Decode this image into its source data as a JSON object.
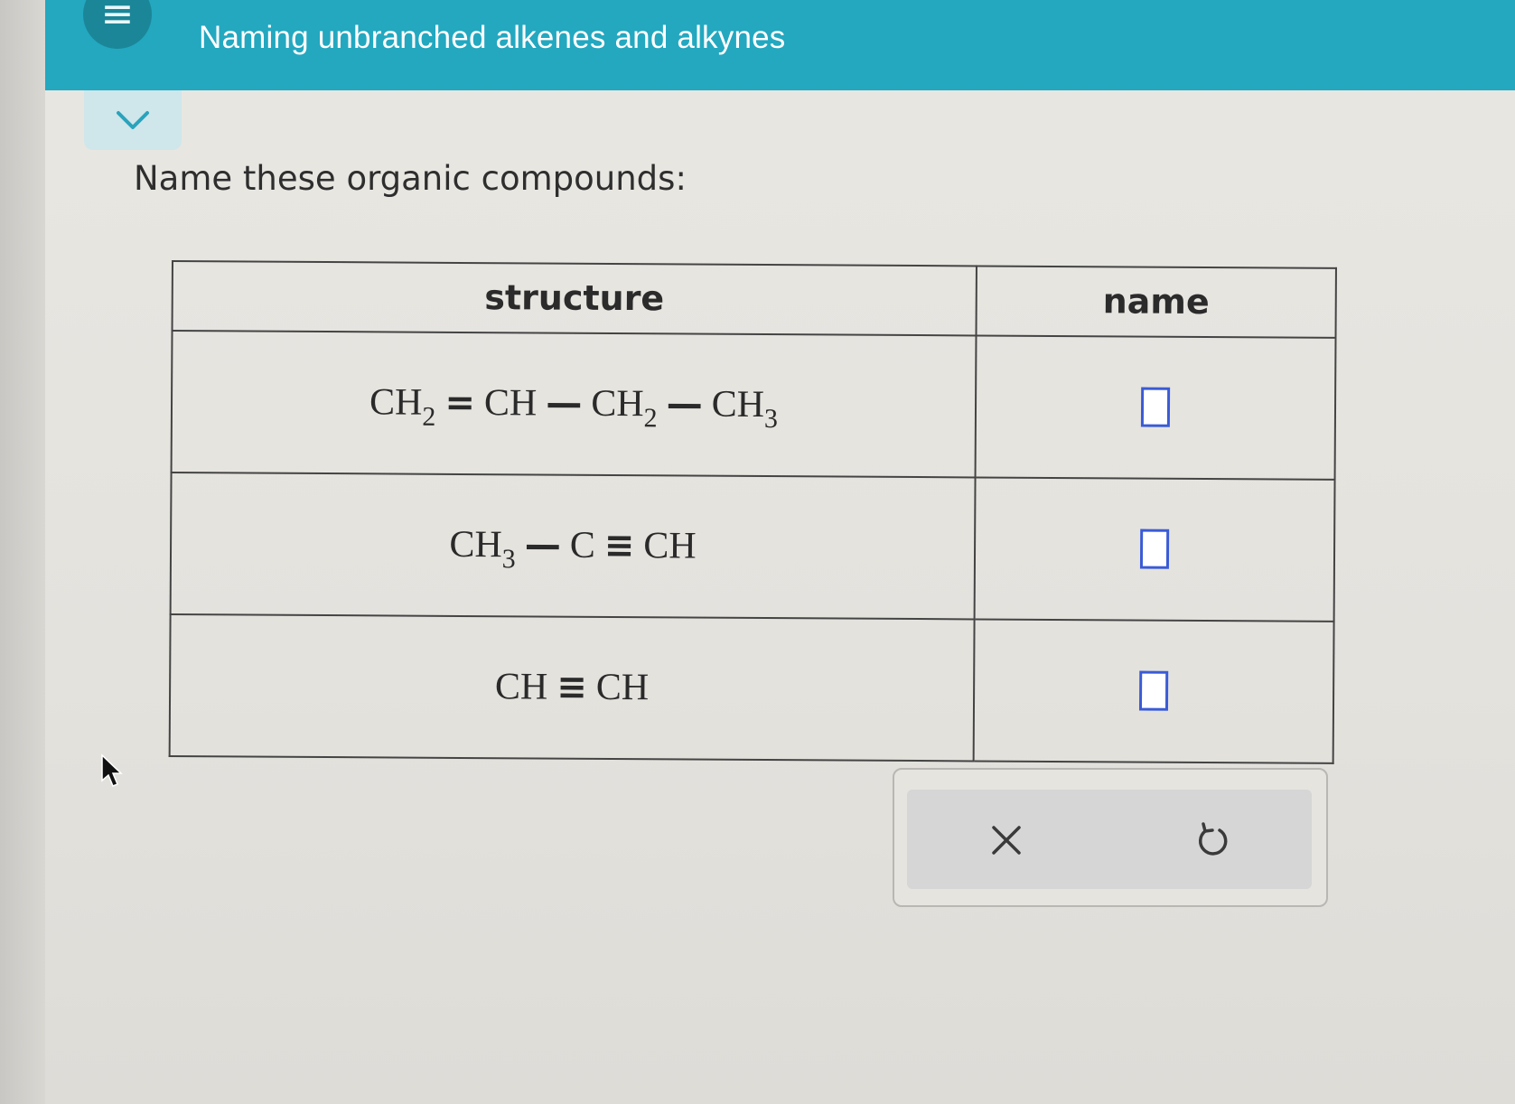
{
  "header": {
    "title": "Naming unbranched alkenes and alkynes",
    "menu_icon": "hamburger-icon"
  },
  "prompt": "Name these organic compounds:",
  "table": {
    "headers": [
      "structure",
      "name"
    ],
    "rows": [
      {
        "parts": [
          "CH",
          "2",
          "=",
          "CH",
          "—",
          "CH",
          "2",
          "—",
          "CH",
          "3"
        ]
      },
      {
        "parts": [
          "CH",
          "3",
          "—",
          "C",
          "≡",
          "CH"
        ]
      },
      {
        "parts": [
          "CH",
          "≡",
          "CH"
        ]
      }
    ]
  },
  "tools": {
    "clear_icon": "x-icon",
    "reset_icon": "undo-icon"
  },
  "colors": {
    "header": "#23a8c0",
    "answer_box_border": "#3a5bd6"
  }
}
